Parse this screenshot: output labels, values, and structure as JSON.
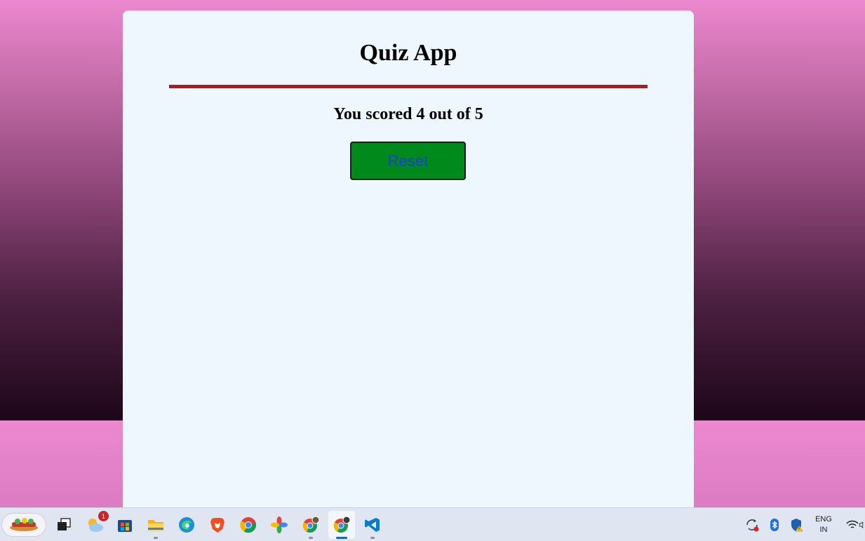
{
  "quiz": {
    "title": "Quiz App",
    "score_text": "You scored 4 out of 5",
    "reset_label": "Reset"
  },
  "colors": {
    "card_bg": "#eef7fd",
    "divider": "#b0191e",
    "button_bg": "#008a1b",
    "button_text": "#1c3fd6"
  },
  "taskbar": {
    "apps": [
      {
        "name": "widgets-icon"
      },
      {
        "name": "task-view-icon"
      },
      {
        "name": "weather-icon",
        "badge": "1"
      },
      {
        "name": "microsoft-store-icon"
      },
      {
        "name": "file-explorer-icon"
      },
      {
        "name": "edge-icon"
      },
      {
        "name": "brave-icon"
      },
      {
        "name": "chrome-icon"
      },
      {
        "name": "photos-icon"
      },
      {
        "name": "chrome-profile-icon"
      },
      {
        "name": "chrome-profile-active-icon"
      },
      {
        "name": "vscode-icon"
      }
    ],
    "tray": {
      "language_line1": "ENG",
      "language_line2": "IN"
    }
  }
}
